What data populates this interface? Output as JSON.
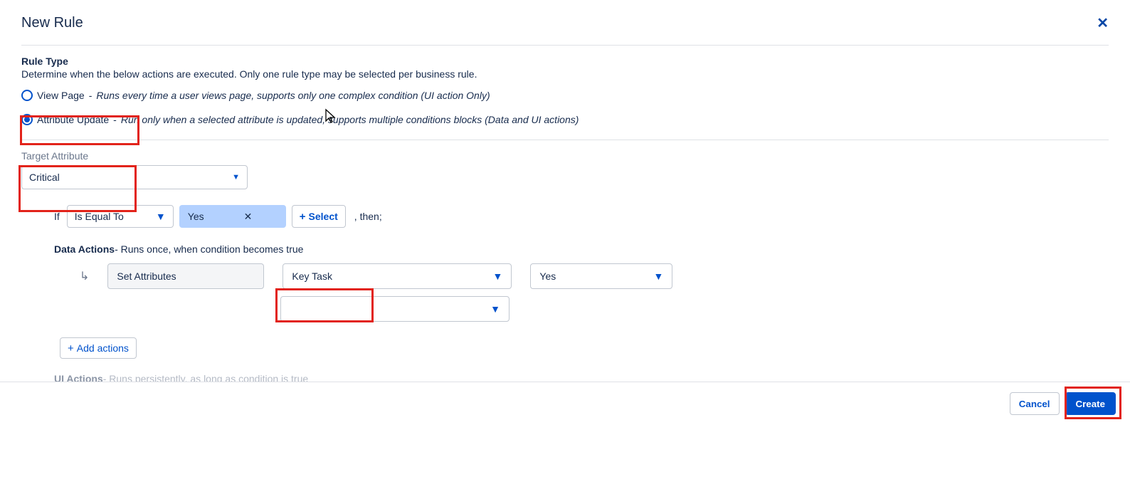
{
  "modal": {
    "title": "New Rule",
    "close": "✕"
  },
  "ruleType": {
    "heading": "Rule Type",
    "description": "Determine when the below actions are executed. Only one rule type may be selected per business rule.",
    "options": [
      {
        "label": "View Page",
        "desc": "Runs every time a user views page, supports only one complex condition (UI action Only)",
        "selected": false
      },
      {
        "label": "Attribute Update",
        "desc": "Run only when a selected attribute is updated, supports multiple conditions blocks (Data and UI actions)",
        "selected": true
      }
    ]
  },
  "targetAttribute": {
    "label": "Target Attribute",
    "value": "Critical"
  },
  "condition": {
    "ifLabel": "If",
    "operator": "Is Equal To",
    "tagValue": "Yes",
    "selectBtn": "Select",
    "then": ", then;"
  },
  "dataActions": {
    "title": "Data Actions",
    "desc": "- Runs once, when condition becomes true",
    "action": {
      "name": "Set Attributes",
      "attr": "Key Task",
      "value": "Yes",
      "secondary": ""
    },
    "addBtn": "Add actions"
  },
  "uiActions": {
    "title": "UI Actions",
    "desc": "- Runs persistently, as long as condition is true"
  },
  "footer": {
    "cancel": "Cancel",
    "create": "Create"
  }
}
